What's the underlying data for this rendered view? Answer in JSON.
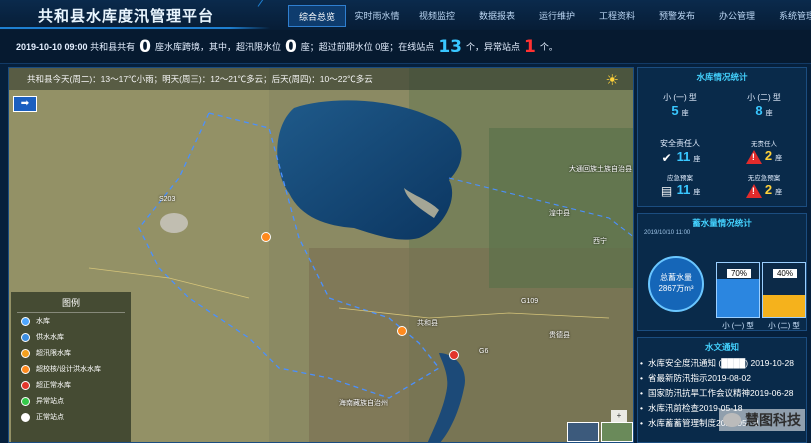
{
  "header": {
    "title": "共和县水库度汛管理平台",
    "tabs": [
      {
        "label": "综合总览",
        "active": true
      },
      {
        "label": "实时雨水情",
        "active": false
      },
      {
        "label": "视频监控",
        "active": false
      },
      {
        "label": "数据报表",
        "active": false
      },
      {
        "label": "运行维护",
        "active": false
      },
      {
        "label": "工程资料",
        "active": false
      },
      {
        "label": "预警发布",
        "active": false
      },
      {
        "label": "办公管理",
        "active": false
      },
      {
        "label": "系统管理",
        "active": false
      }
    ]
  },
  "status": {
    "datetime": "2019-10-10 09:00",
    "text1": "共和县共有",
    "count_total": "0",
    "text2": "座水库跨境，其中，超汛限水位",
    "count_over": "0",
    "text3": "座；超过前期水位 0座；在线站点",
    "online_sites": "13",
    "text4": "个，异常站点",
    "abnormal_sites": "1",
    "text5": "个。"
  },
  "map": {
    "weather": "共和县今天(周二)：13～17℃小雨；明天(周三)：12～21℃多云；后天(周四)：10～22℃多云",
    "legend": {
      "title": "图例",
      "items": [
        {
          "label": "水库",
          "color": "#4da6ff"
        },
        {
          "label": "供水水库",
          "color": "#3b8de0"
        },
        {
          "label": "超汛限水库",
          "color": "#f2a01e"
        },
        {
          "label": "超校核/设计洪水水库",
          "color": "#ff8a1e"
        },
        {
          "label": "超正常水库",
          "color": "#e2352b"
        },
        {
          "label": "异常站点",
          "color": "#35c94a"
        },
        {
          "label": "正常站点",
          "color": "#ffffff"
        }
      ]
    },
    "labels": [
      {
        "text": "S203"
      },
      {
        "text": "大通回族土族自治县"
      },
      {
        "text": "湟中县"
      },
      {
        "text": "西宁"
      },
      {
        "text": "共和县"
      },
      {
        "text": "海南藏族自治州"
      },
      {
        "text": "贵德县"
      },
      {
        "text": "G109"
      },
      {
        "text": "G6"
      }
    ]
  },
  "panel": {
    "reservoir_stats": {
      "title": "水库情况统计",
      "small1_label": "小 (一) 型",
      "small1_value": "5",
      "small2_label": "小 (二) 型",
      "small2_value": "8",
      "unit": "座",
      "safety_label": "安全责任人",
      "safety_value": "11",
      "safety_warn_label": "无责任人",
      "safety_warn_value": "2",
      "plan_label": "应急预案",
      "plan_value": "11",
      "plan_warn_label": "无应急预案",
      "plan_warn_value": "2"
    },
    "storage": {
      "title": "蓄水量情况统计",
      "time": "2019/10/10 11:00",
      "total_label": "总蓄水量",
      "total_value": "2867万m³",
      "tank1_pct": 70,
      "tank1_pct_label": "70%",
      "tank1_label": "小 (一) 型",
      "tank2_pct": 40,
      "tank2_pct_label": "40%",
      "tank2_label": "小 (二) 型"
    },
    "notices": {
      "title": "水文通知",
      "items": [
        "水库安全度汛通知 (████) 2019-10-28",
        "省最新防汛指示2019-08-02",
        "国家防汛抗旱工作会议精神2019-06-28",
        "水库汛前检查2019-05-18",
        "水库蓄蓄管理制度2019 05 38"
      ]
    }
  },
  "watermark": "慧图科技",
  "colors": {
    "background": "#06203c",
    "accent": "#39c7ff",
    "alert": "#ff3131",
    "tank1": "#2b86e0",
    "tank2": "#f5b21c"
  }
}
